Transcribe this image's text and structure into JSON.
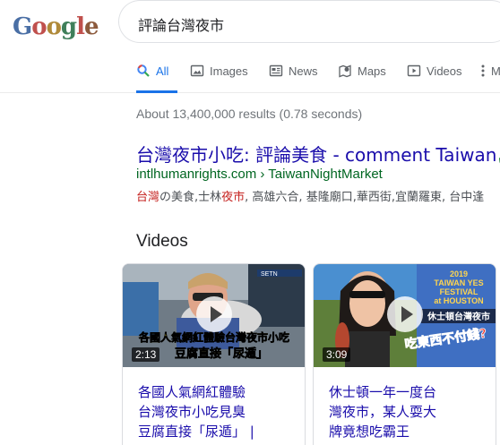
{
  "logo": {
    "letters": [
      "G",
      "o",
      "o",
      "g",
      "l",
      "e"
    ]
  },
  "search": {
    "query": "評論台灣夜市"
  },
  "tabs": [
    {
      "label": "All",
      "icon": "search-icon",
      "active": true
    },
    {
      "label": "Images",
      "icon": "image-icon",
      "active": false
    },
    {
      "label": "News",
      "icon": "news-icon",
      "active": false
    },
    {
      "label": "Maps",
      "icon": "map-pin-icon",
      "active": false
    },
    {
      "label": "Videos",
      "icon": "play-icon",
      "active": false
    },
    {
      "label": "M",
      "icon": "more-vertical-icon",
      "active": false
    }
  ],
  "stats": "About 13,400,000 results (0.78 seconds)",
  "result": {
    "title": "台灣夜市小吃: 評論美食 - comment Taiwan",
    "url": "intlhumanrights.com › TaiwanNightMarket",
    "snippet_hl1": "台灣",
    "snippet_part1": "の美食,士林",
    "snippet_hl2": "夜市",
    "snippet_part2": ", 高雄六合, 基隆廟口,華西街,宜蘭羅東, 台中逢"
  },
  "videos": {
    "heading": "Videos",
    "items": [
      {
        "title_lines": [
          "各國人氣網紅體驗",
          "台灣夜市小吃見臭",
          "豆腐直接「尿遁」 |"
        ],
        "duration": "2:13",
        "caption_top": "各國人氣網紅體驗台灣夜市小吃",
        "caption_bottom": "豆腐直接「尿遁」",
        "channel_tag": "SETN"
      },
      {
        "title_lines": [
          "休士頓一年一度台",
          "灣夜市，某人耍大",
          "牌竟想吃霸王"
        ],
        "duration": "3:09",
        "overlay_title_lines": [
          "2019",
          "TAIWAN YES",
          "FESTIVAL",
          "at HOUSTON"
        ],
        "overlay_banner": "休士頓台灣夜市",
        "overlay_red": "吃東西不付錢?"
      }
    ]
  },
  "colors": {
    "link": "#1a0dab",
    "url_green": "#006621",
    "accent_blue": "#1a73e8",
    "highlight_red": "#c5221f"
  }
}
